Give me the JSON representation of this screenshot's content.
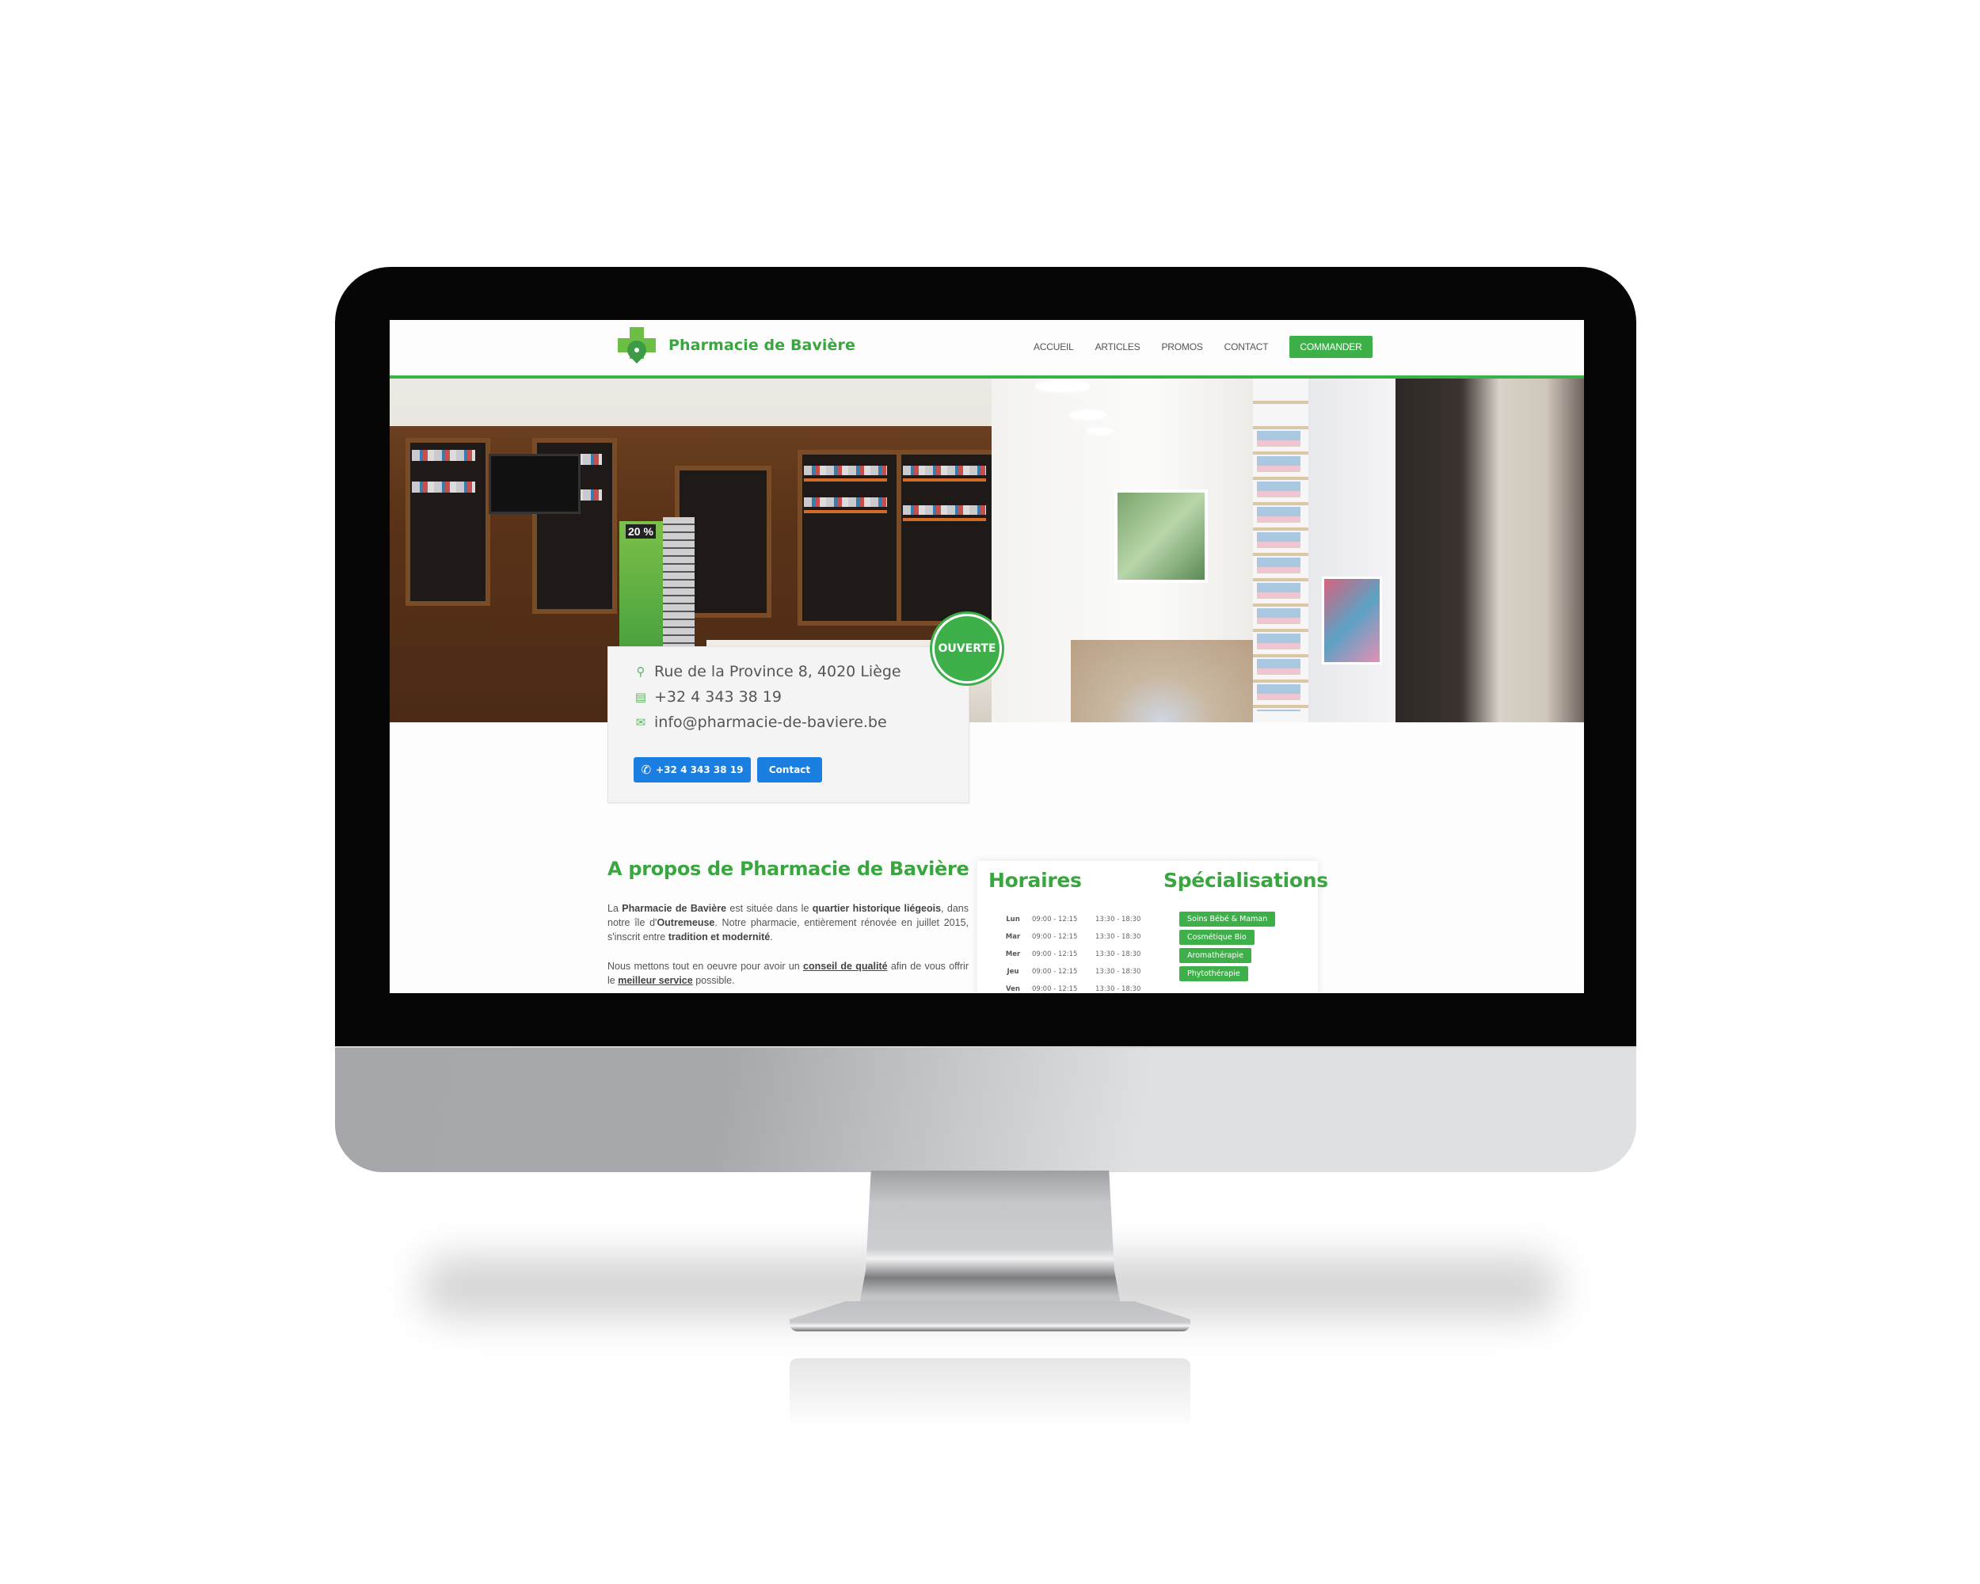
{
  "site": {
    "brand": "Pharmacie de Bavière",
    "nav": [
      {
        "label": "ACCUEIL"
      },
      {
        "label": "ARTICLES"
      },
      {
        "label": "PROMOS"
      },
      {
        "label": "CONTACT"
      }
    ],
    "cta_label": "COMMANDER",
    "colors": {
      "accent": "#3db049",
      "button_blue": "#1a7fe0",
      "text": "#555555"
    }
  },
  "hero": {
    "promo_label": "20 %",
    "status_badge": "OUVERTE"
  },
  "contact": {
    "address": "Rue de la Province 8, 4020 Liège",
    "phone": "+32 4 343 38 19",
    "email": "info@pharmacie-de-baviere.be",
    "call_button": "+32 4 343 38 19",
    "contact_button": "Contact",
    "icons": {
      "address": "map-pin-icon",
      "phone": "fax-phone-icon",
      "email": "envelope-icon",
      "call": "phone-icon"
    }
  },
  "about": {
    "title": "A propos de Pharmacie de Bavière",
    "p1": {
      "t1": "La ",
      "b1": "Pharmacie de Bavière",
      "t2": " est située dans le ",
      "b2": "quartier historique liégeois",
      "t3": ", dans notre île d'",
      "b3": "Outremeuse",
      "t4": ". Notre pharmacie, entièrement rénovée en juillet 2015,  s'inscrit entre ",
      "b4": "tradition et modernité",
      "t5": "."
    },
    "p2": {
      "t1": "Nous mettons tout en oeuvre pour avoir un ",
      "u1": "conseil de qualité",
      "t2": " afin de vous offrir le ",
      "u2": "meilleur service",
      "t3": " possible."
    }
  },
  "hours": {
    "title": "Horaires",
    "rows": [
      {
        "day": "Lun",
        "morning": "09:00 - 12:15",
        "afternoon": "13:30 - 18:30"
      },
      {
        "day": "Mar",
        "morning": "09:00 - 12:15",
        "afternoon": "13:30 - 18:30"
      },
      {
        "day": "Mer",
        "morning": "09:00 - 12:15",
        "afternoon": "13:30 - 18:30"
      },
      {
        "day": "Jeu",
        "morning": "09:00 - 12:15",
        "afternoon": "13:30 - 18:30"
      },
      {
        "day": "Ven",
        "morning": "09:00 - 12:15",
        "afternoon": "13:30 - 18:30"
      }
    ]
  },
  "specializations": {
    "title": "Spécialisations",
    "tags": [
      "Soins Bébé & Maman",
      "Cosmétique Bio",
      "Aromathérapie",
      "Phytothérapie"
    ]
  }
}
